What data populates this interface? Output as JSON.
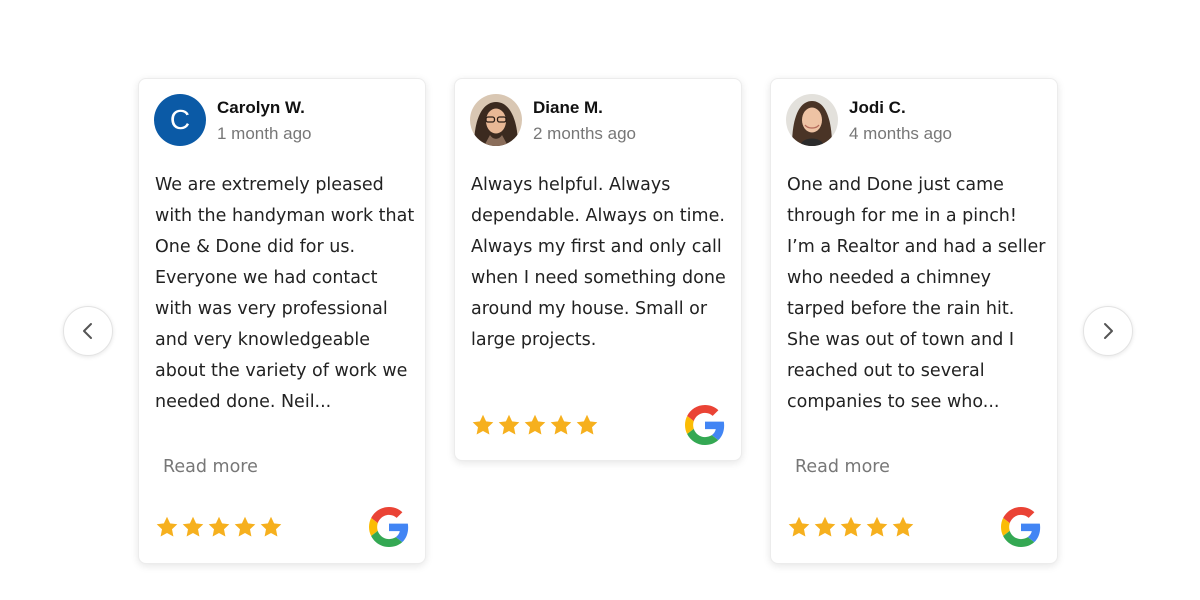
{
  "carousel": {
    "prev_icon": "chevron-left-icon",
    "next_icon": "chevron-right-icon",
    "colors": {
      "star": "#f6b01e",
      "avatar_initial_bg": "#0b5aa6",
      "meta_text": "#777777"
    },
    "reviews": [
      {
        "name": "Carolyn W.",
        "date": "1 month ago",
        "avatar_initial": "C",
        "text": "We are extremely pleased with the handyman work that One & Done did for us. Everyone we had contact with was very professional and very knowledgeable about the variety of work we needed done. Neil...",
        "read_more": "Read more",
        "rating": 5,
        "source_icon": "google-icon"
      },
      {
        "name": "Diane M.",
        "date": "2 months ago",
        "avatar_initial": "",
        "text": "Always helpful. Always dependable. Always on time. Always my first and only call when I need something done around my house. Small or large projects.",
        "read_more": "",
        "rating": 5,
        "source_icon": "google-icon"
      },
      {
        "name": "Jodi C.",
        "date": "4 months ago",
        "avatar_initial": "",
        "text": "One and Done just came through for me in a pinch! I’m a Realtor and had a seller who needed a chimney tarped before the rain hit. She was out of town and I reached out to several companies to see who...",
        "read_more": "Read more",
        "rating": 5,
        "source_icon": "google-icon"
      }
    ]
  }
}
